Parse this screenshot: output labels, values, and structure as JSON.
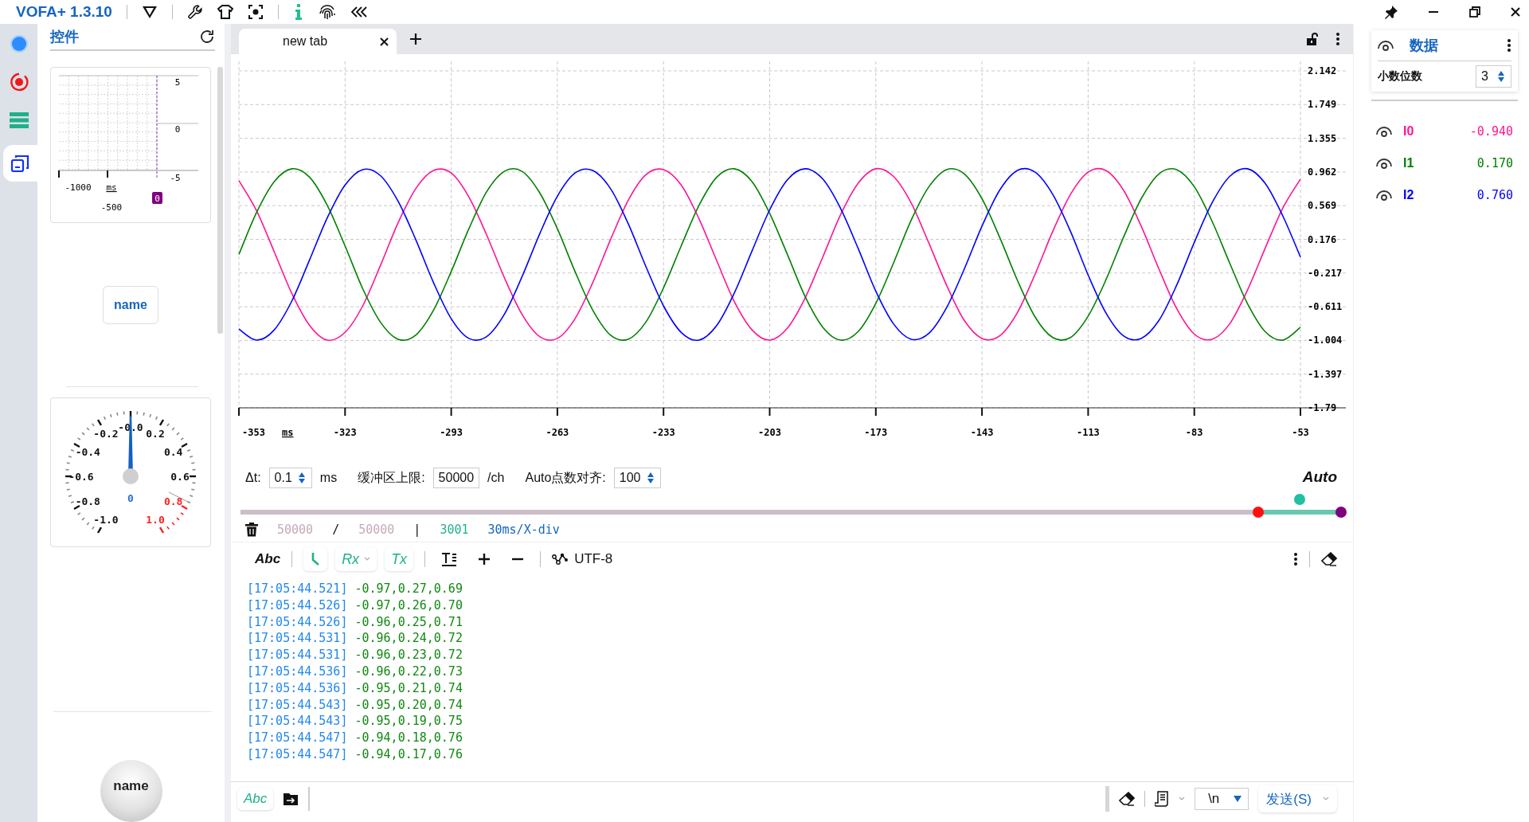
{
  "window": {
    "title": "VOFA+ 1.3.10"
  },
  "left_rail": {
    "items": [
      {
        "kind": "status",
        "selected": false
      },
      {
        "kind": "record",
        "selected": false
      },
      {
        "kind": "list",
        "selected": false
      },
      {
        "kind": "widgets",
        "selected": true
      }
    ]
  },
  "widgets_panel": {
    "title": "控件",
    "mini_plot": {
      "y_labels": [
        "5",
        "0",
        "-5"
      ],
      "x_labels": [
        "-1000",
        "-500"
      ],
      "unit": "ms",
      "cursor_label": "0"
    },
    "button": {
      "label": "name"
    },
    "gauge": {
      "level": 0.5,
      "value": "0",
      "labels": [
        {
          "text": "-1.0",
          "warning": false
        },
        {
          "text": "-0.8",
          "warning": false
        },
        {
          "text": "-0.6",
          "warning": false
        },
        {
          "text": "-0.4",
          "warning": false
        },
        {
          "text": "-0.2",
          "warning": false
        },
        {
          "text": "-0.0",
          "warning": false
        },
        {
          "text": "0.2",
          "warning": false
        },
        {
          "text": "0.4",
          "warning": false
        },
        {
          "text": "0.6",
          "warning": false
        },
        {
          "text": "0.8",
          "warning": true
        },
        {
          "text": "1.0",
          "warning": true
        }
      ]
    },
    "round_button": {
      "label": "name"
    }
  },
  "tabs": [
    {
      "label": "new tab",
      "selected": true
    }
  ],
  "plot": {
    "chart_data": {
      "type": "line",
      "xlabel": "ms",
      "grid": true,
      "x": [
        -353,
        -348,
        -343,
        -338,
        -333,
        -328,
        -323,
        -318,
        -313,
        -308,
        -303,
        -298,
        -293,
        -288,
        -283,
        -278,
        -273,
        -268,
        -263,
        -258,
        -253,
        -248,
        -243,
        -238,
        -233,
        -228,
        -223,
        -218,
        -213,
        -208,
        -203,
        -198,
        -193,
        -188,
        -183,
        -178,
        -173,
        -168,
        -163,
        -158,
        -153,
        -148,
        -143,
        -138,
        -133,
        -128,
        -123,
        -118,
        -113,
        -108,
        -103,
        -98,
        -93,
        -88,
        -83,
        -78,
        -73,
        -68,
        -63,
        -58,
        -53
      ],
      "series": [
        {
          "color": "#ff1493",
          "values": [
            0.86,
            0.51,
            0.03,
            -0.46,
            -0.83,
            -1.0,
            -0.91,
            -0.6,
            -0.13,
            0.37,
            0.77,
            0.98,
            0.95,
            0.67,
            0.23,
            -0.27,
            -0.7,
            -0.96,
            -0.98,
            -0.75,
            -0.33,
            0.17,
            0.63,
            0.93,
            0.99,
            0.81,
            0.42,
            -0.07,
            -0.55,
            -0.88,
            -1.0,
            -0.86,
            -0.51,
            -0.03,
            0.46,
            0.83,
            1.0,
            0.91,
            0.6,
            0.13,
            -0.36,
            -0.77,
            -0.98,
            -0.95,
            -0.68,
            -0.23,
            0.27,
            0.7,
            0.96,
            0.98,
            0.75,
            0.33,
            -0.17,
            -0.63,
            -0.93,
            -0.99,
            -0.81,
            -0.42,
            0.07,
            0.54,
            0.88
          ]
        },
        {
          "color": "#008000",
          "values": [
            0.0,
            0.49,
            0.85,
            1.0,
            0.9,
            0.57,
            0.1,
            -0.4,
            -0.79,
            -0.99,
            -0.94,
            -0.65,
            -0.2,
            0.3,
            0.73,
            0.97,
            0.97,
            0.72,
            0.3,
            -0.2,
            -0.65,
            -0.94,
            -0.99,
            -0.79,
            -0.39,
            0.1,
            0.57,
            0.9,
            1.0,
            0.85,
            0.48,
            0.0,
            -0.49,
            -0.85,
            -1.0,
            -0.9,
            -0.57,
            -0.1,
            0.4,
            0.79,
            0.99,
            0.94,
            0.65,
            0.2,
            -0.3,
            -0.73,
            -0.97,
            -0.97,
            -0.72,
            -0.3,
            0.2,
            0.65,
            0.94,
            0.99,
            0.79,
            0.39,
            -0.1,
            -0.57,
            -0.9,
            -1.0,
            -0.85
          ]
        },
        {
          "color": "#0000ff",
          "values": [
            -0.87,
            -1.0,
            -0.88,
            -0.54,
            -0.06,
            0.43,
            0.81,
            0.99,
            0.92,
            0.62,
            0.17,
            -0.33,
            -0.75,
            -0.98,
            -0.96,
            -0.7,
            -0.26,
            0.24,
            0.68,
            0.95,
            0.98,
            0.77,
            0.36,
            -0.14,
            -0.6,
            -0.91,
            -1.0,
            -0.83,
            -0.45,
            0.04,
            0.52,
            0.87,
            1.0,
            0.88,
            0.54,
            0.07,
            -0.43,
            -0.81,
            -0.99,
            -0.92,
            -0.62,
            -0.17,
            0.33,
            0.75,
            0.98,
            0.96,
            0.7,
            0.27,
            -0.24,
            -0.68,
            -0.95,
            -0.98,
            -0.77,
            -0.36,
            0.14,
            0.6,
            0.91,
            1.0,
            0.83,
            0.45,
            -0.03
          ]
        }
      ],
      "xlim": [
        -353,
        -53
      ],
      "ylim": [
        -1.79,
        2.142
      ],
      "xticks": [
        -353,
        -323,
        -293,
        -263,
        -233,
        -203,
        -173,
        -143,
        -113,
        -83,
        -53
      ],
      "yticks": [
        2.142,
        1.749,
        1.355,
        0.962,
        0.569,
        0.176,
        -0.217,
        -0.611,
        -1.004,
        -1.397,
        -1.79
      ]
    }
  },
  "settings": {
    "dt_label": "Δt:",
    "dt_value": "0.1",
    "dt_unit": "ms",
    "buffer_label": "缓冲区上限:",
    "buffer_value": "50000",
    "buffer_unit": "/ch",
    "align_label": "Auto点数对齐:",
    "align_value": "100",
    "mode": "Auto"
  },
  "range": {
    "start": {
      "level": 0.925
    },
    "end": {
      "level": 1.0
    }
  },
  "stats": {
    "buffered": "50000",
    "slash": "/",
    "capacity": "50000",
    "bar": "|",
    "points": "3001",
    "scale": "30ms/X-div"
  },
  "log_toolbar": {
    "format_label": "Abc",
    "timestamp_on": true,
    "rx_label": "Rx",
    "rx_on": true,
    "tx_label": "Tx",
    "tx_on": true,
    "encoding": "UTF-8"
  },
  "log": [
    {
      "time": "[17:05:44.521]",
      "values": "-0.97,0.27,0.69"
    },
    {
      "time": "[17:05:44.526]",
      "values": "-0.97,0.26,0.70"
    },
    {
      "time": "[17:05:44.526]",
      "values": "-0.96,0.25,0.71"
    },
    {
      "time": "[17:05:44.531]",
      "values": "-0.96,0.24,0.72"
    },
    {
      "time": "[17:05:44.531]",
      "values": "-0.96,0.23,0.72"
    },
    {
      "time": "[17:05:44.536]",
      "values": "-0.96,0.22,0.73"
    },
    {
      "time": "[17:05:44.536]",
      "values": "-0.95,0.21,0.74"
    },
    {
      "time": "[17:05:44.543]",
      "values": "-0.95,0.20,0.74"
    },
    {
      "time": "[17:05:44.543]",
      "values": "-0.95,0.19,0.75"
    },
    {
      "time": "[17:05:44.547]",
      "values": "-0.94,0.18,0.76"
    },
    {
      "time": "[17:05:44.547]",
      "values": "-0.94,0.17,0.76"
    }
  ],
  "send_bar": {
    "format_label": "Abc",
    "line_ending": "\\n",
    "send_label": "发送(S)"
  },
  "data_panel": {
    "title": "数据",
    "decimals_label": "小数位数",
    "decimals_value": "3",
    "channels": [
      {
        "name": "I0",
        "value": "-0.940",
        "color": "#ff1493"
      },
      {
        "name": "I1",
        "value": "0.170",
        "color": "#008000"
      },
      {
        "name": "I2",
        "value": "0.760",
        "color": "#0000ff"
      }
    ]
  }
}
